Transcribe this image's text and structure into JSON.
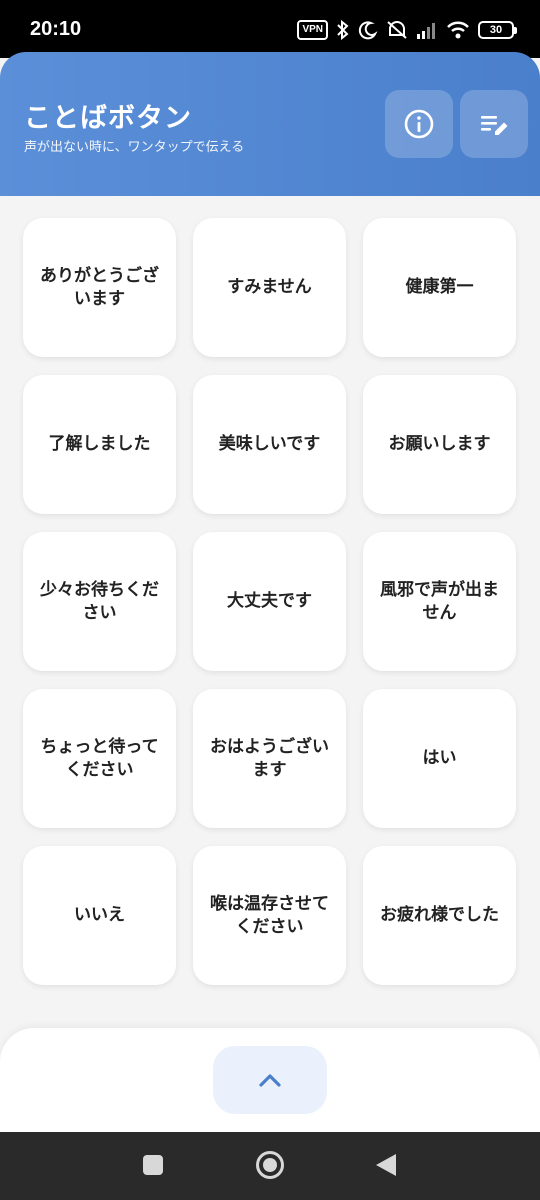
{
  "status_bar": {
    "time": "20:10",
    "vpn_label": "VPN",
    "battery_level": "30",
    "icons": [
      "vpn-icon",
      "bluetooth-icon",
      "moon-icon",
      "mute-icon",
      "signal-icon",
      "wifi-icon",
      "battery-icon"
    ]
  },
  "header": {
    "title": "ことばボタン",
    "subtitle": "声が出ない時に、ワンタップで伝える",
    "info_icon": "info-icon",
    "edit_icon": "edit-list-icon",
    "color": "#5588d4"
  },
  "phrases": [
    "ありがとうございます",
    "すみません",
    "健康第一",
    "了解しました",
    "美味しいです",
    "お願いします",
    "少々お待ちください",
    "大丈夫です",
    "風邪で声が出ません",
    "ちょっと待ってください",
    "おはようございます",
    "はい",
    "いいえ",
    "喉は温存させてください",
    "お疲れ様でした"
  ],
  "bottom_sheet": {
    "expand_icon": "chevron-up-icon",
    "accent": "#4a7fcc"
  },
  "nav_bar": {
    "icons": [
      "recent-apps-icon",
      "home-icon",
      "back-icon"
    ]
  }
}
